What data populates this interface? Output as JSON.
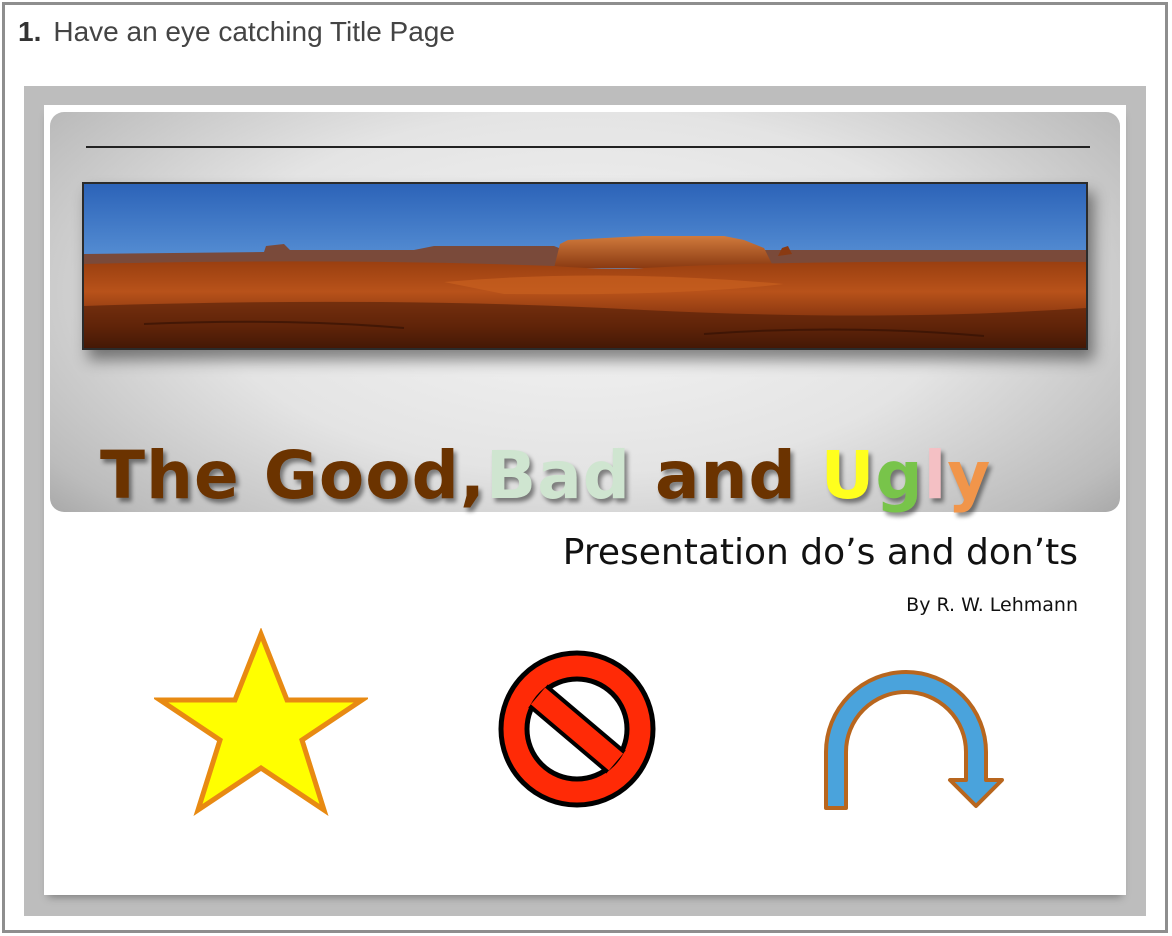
{
  "step": {
    "number": "1.",
    "text": "Have an eye catching Title Page"
  },
  "slide": {
    "title_parts": [
      {
        "text": "The Good, ",
        "color": "#6b3300"
      },
      {
        "text": "Bad",
        "color": "#cfe5d0"
      },
      {
        "text": " and ",
        "color": "#6b3300"
      },
      {
        "text": "U",
        "color": "#ffff1e"
      },
      {
        "text": "g",
        "color": "#78c44a"
      },
      {
        "text": "l",
        "color": "#f4c0c4"
      },
      {
        "text": "y",
        "color": "#f1954a"
      }
    ],
    "subtitle": "Presentation do’s and don’ts",
    "byline": "By R. W. Lehmann",
    "photo": "desert-mesa-panorama",
    "icons": [
      "star-icon",
      "prohibition-icon",
      "curved-arrow-icon"
    ]
  },
  "colors": {
    "frame": "#8e8e8e",
    "slide_border": "#bdbdbd",
    "title_brown": "#6b3300",
    "star_fill": "#ffff00",
    "star_stroke": "#e88a12",
    "prohibit_red": "#ff2a06",
    "arrow_blue": "#4aa3dc",
    "arrow_stroke": "#b8661e"
  }
}
